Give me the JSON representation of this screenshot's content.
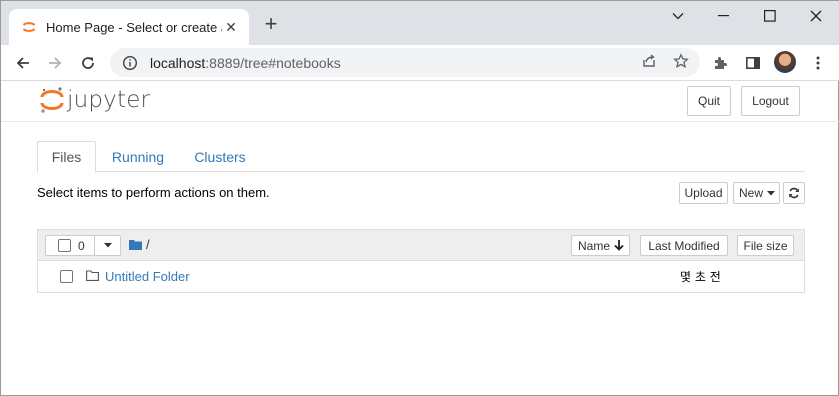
{
  "browser": {
    "tab_title": "Home Page - Select or create a notebook",
    "tab_close_icon": "close-icon",
    "new_tab_icon": "plus-icon",
    "url_host": "localhost",
    "url_rest": ":8889/tree#notebooks",
    "window_controls": [
      "minimize-icon",
      "maximize-icon",
      "close-icon"
    ]
  },
  "header": {
    "logo_text": "jupyter",
    "quit_label": "Quit",
    "logout_label": "Logout"
  },
  "tabs": [
    {
      "label": "Files",
      "active": true
    },
    {
      "label": "Running",
      "active": false
    },
    {
      "label": "Clusters",
      "active": false
    }
  ],
  "hint": "Select items to perform actions on them.",
  "actions": {
    "upload_label": "Upload",
    "new_label": "New",
    "refresh_icon": "refresh-icon"
  },
  "list": {
    "selected_count": "0",
    "breadcrumb": "/",
    "sort_name_label": "Name",
    "last_modified_label": "Last Modified",
    "file_size_label": "File size",
    "items": [
      {
        "name": "Untitled Folder",
        "type": "folder",
        "modified": "몇 초 전"
      }
    ]
  },
  "colors": {
    "link": "#337ab7",
    "jupyter_orange": "#f37726",
    "tabstrip": "#dee1e6"
  }
}
